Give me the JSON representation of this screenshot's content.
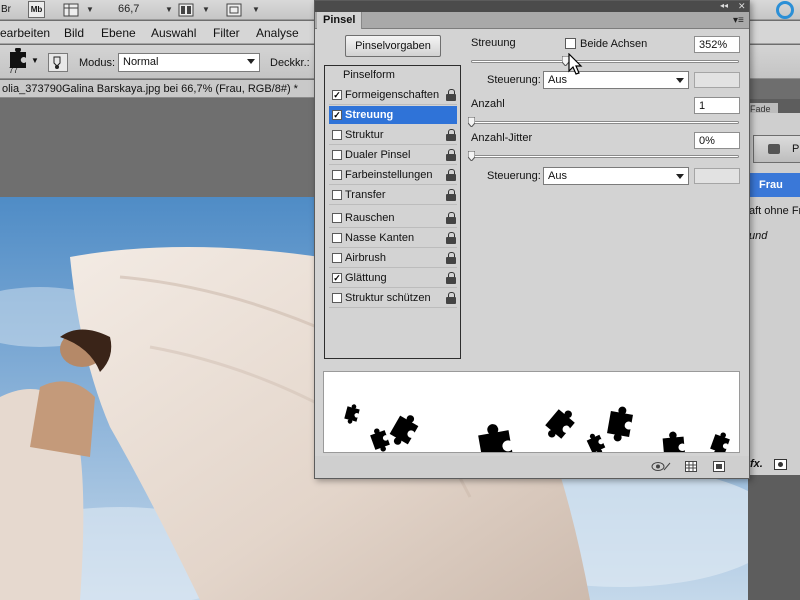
{
  "appbar": {
    "left_icon": "Br",
    "mb_icon": "Mb",
    "zoom": "66,7"
  },
  "menubar": {
    "items": [
      "earbeiten",
      "Bild",
      "Ebene",
      "Auswahl",
      "Filter",
      "Analyse"
    ]
  },
  "options": {
    "brush_size": "77",
    "modus_label": "Modus:",
    "modus_value": "Normal",
    "deckkr_label": "Deckkr.:"
  },
  "document": {
    "tab_title": "olia_373790Galina Barskaya.jpg bei 66,7% (Frau, RGB/8#) *"
  },
  "right_panel": {
    "fade_tab": "Fade",
    "tab_label": "Pi",
    "selected_layer": "Frau",
    "line1": "aft ohne Fra",
    "line2": "und"
  },
  "brush_panel": {
    "tab": "Pinsel",
    "presets_button": "Pinselvorgaben",
    "list_header": "Pinselform",
    "list_items": [
      {
        "label": "Formeigenschaften",
        "checked": true,
        "selected": false
      },
      {
        "label": "Streuung",
        "checked": true,
        "selected": true
      },
      {
        "label": "Struktur",
        "checked": false,
        "selected": false
      },
      {
        "label": "Dualer Pinsel",
        "checked": false,
        "selected": false
      },
      {
        "label": "Farbeinstellungen",
        "checked": false,
        "selected": false
      },
      {
        "label": "Transfer",
        "checked": false,
        "selected": false
      },
      {
        "label": "Rauschen",
        "checked": false,
        "selected": false
      },
      {
        "label": "Nasse Kanten",
        "checked": false,
        "selected": false
      },
      {
        "label": "Airbrush",
        "checked": false,
        "selected": false
      },
      {
        "label": "Glättung",
        "checked": true,
        "selected": false
      },
      {
        "label": "Struktur schützen",
        "checked": false,
        "selected": false
      }
    ],
    "streuung": {
      "label": "Streuung",
      "beide_achsen_label": "Beide Achsen",
      "beide_achsen_checked": false,
      "value": "352%",
      "slider_fraction": 0.35,
      "steuerung_label": "Steuerung:",
      "steuerung_value": "Aus"
    },
    "anzahl": {
      "label": "Anzahl",
      "value": "1",
      "slider_fraction": 0.0
    },
    "anzahl_jitter": {
      "label": "Anzahl-Jitter",
      "value": "0%",
      "slider_fraction": 0.0,
      "steuerung_label": "Steuerung:",
      "steuerung_value": "Aus"
    }
  },
  "colors": {
    "selection_blue": "#2f73d8",
    "sky_top": "#5b95c9",
    "sky_bottom": "#b9d2e8",
    "cloth": "#eadfd6"
  }
}
